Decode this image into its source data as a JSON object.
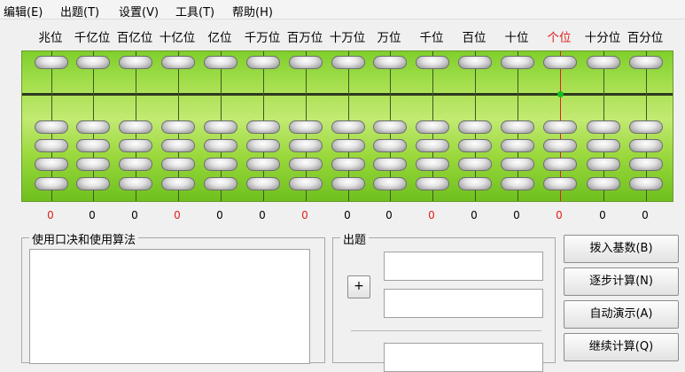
{
  "menu": [
    "编辑(E)",
    "出题(T)",
    "设置(V)",
    "工具(T)",
    "帮助(H)"
  ],
  "columns": [
    {
      "label": "兆位",
      "value": "0",
      "highlight": true
    },
    {
      "label": "千亿位",
      "value": "0",
      "highlight": false
    },
    {
      "label": "百亿位",
      "value": "0",
      "highlight": false
    },
    {
      "label": "十亿位",
      "value": "0",
      "highlight": true
    },
    {
      "label": "亿位",
      "value": "0",
      "highlight": false
    },
    {
      "label": "千万位",
      "value": "0",
      "highlight": false
    },
    {
      "label": "百万位",
      "value": "0",
      "highlight": true
    },
    {
      "label": "十万位",
      "value": "0",
      "highlight": false
    },
    {
      "label": "万位",
      "value": "0",
      "highlight": false
    },
    {
      "label": "千位",
      "value": "0",
      "highlight": true
    },
    {
      "label": "百位",
      "value": "0",
      "highlight": false
    },
    {
      "label": "十位",
      "value": "0",
      "highlight": false
    },
    {
      "label": "个位",
      "value": "0",
      "highlight": true
    },
    {
      "label": "十分位",
      "value": "0",
      "highlight": false
    },
    {
      "label": "百分位",
      "value": "0",
      "highlight": false
    }
  ],
  "unit_column_label": "个位",
  "colors": {
    "highlight": "#e02020",
    "normal": "#000000",
    "board": "#9ad83c",
    "unit_rod": "#e02020"
  },
  "panels": {
    "formula_title": "使用口决和使用算法",
    "question_title": "出题",
    "plus_label": "+"
  },
  "buttons": {
    "set_base": "拨入基数(B)",
    "step_calc": "逐步计算(N)",
    "auto_demo": "自动演示(A)",
    "continue_calc": "继续计算(Q)"
  }
}
